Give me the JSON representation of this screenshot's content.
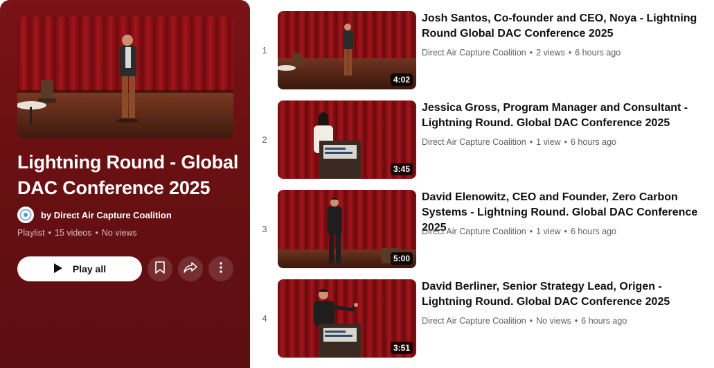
{
  "playlist": {
    "title": "Lightning Round - Global DAC Conference 2025",
    "owner": "by Direct Air Capture Coalition",
    "type": "Playlist",
    "video_count": "15 videos",
    "views": "No views",
    "separator": "•",
    "play_all_label": "Play all"
  },
  "videos": [
    {
      "index": "1",
      "duration": "4:02",
      "title": "Josh Santos, Co-founder and CEO, Noya - Lightning Round Global DAC Conference 2025",
      "channel": "Direct Air Capture Coalition",
      "views": "2 views",
      "age": "6 hours ago"
    },
    {
      "index": "2",
      "duration": "3:45",
      "title": "Jessica Gross, Program Manager and Consultant - Lightning Round. Global DAC Conference 2025",
      "channel": "Direct Air Capture Coalition",
      "views": "1 view",
      "age": "6 hours ago"
    },
    {
      "index": "3",
      "duration": "5:00",
      "title": "David Elenowitz, CEO and Founder, Zero Carbon Systems - Lightning Round. Global DAC Conference 2025",
      "channel": "Direct Air Capture Coalition",
      "views": "1 view",
      "age": "6 hours ago"
    },
    {
      "index": "4",
      "duration": "3:51",
      "title": "David Berliner, Senior Strategy Lead, Origen - Lightning Round. Global DAC Conference 2025",
      "channel": "Direct Air Capture Coalition",
      "views": "No views",
      "age": "6 hours ago"
    }
  ],
  "colors": {
    "panel_background": "#6a1013",
    "stage_curtain": "#8e1115",
    "stage_floor": "#5a2414"
  },
  "icons": [
    "play-icon",
    "save-icon",
    "share-icon",
    "more-icon",
    "channel-avatar-icon"
  ]
}
